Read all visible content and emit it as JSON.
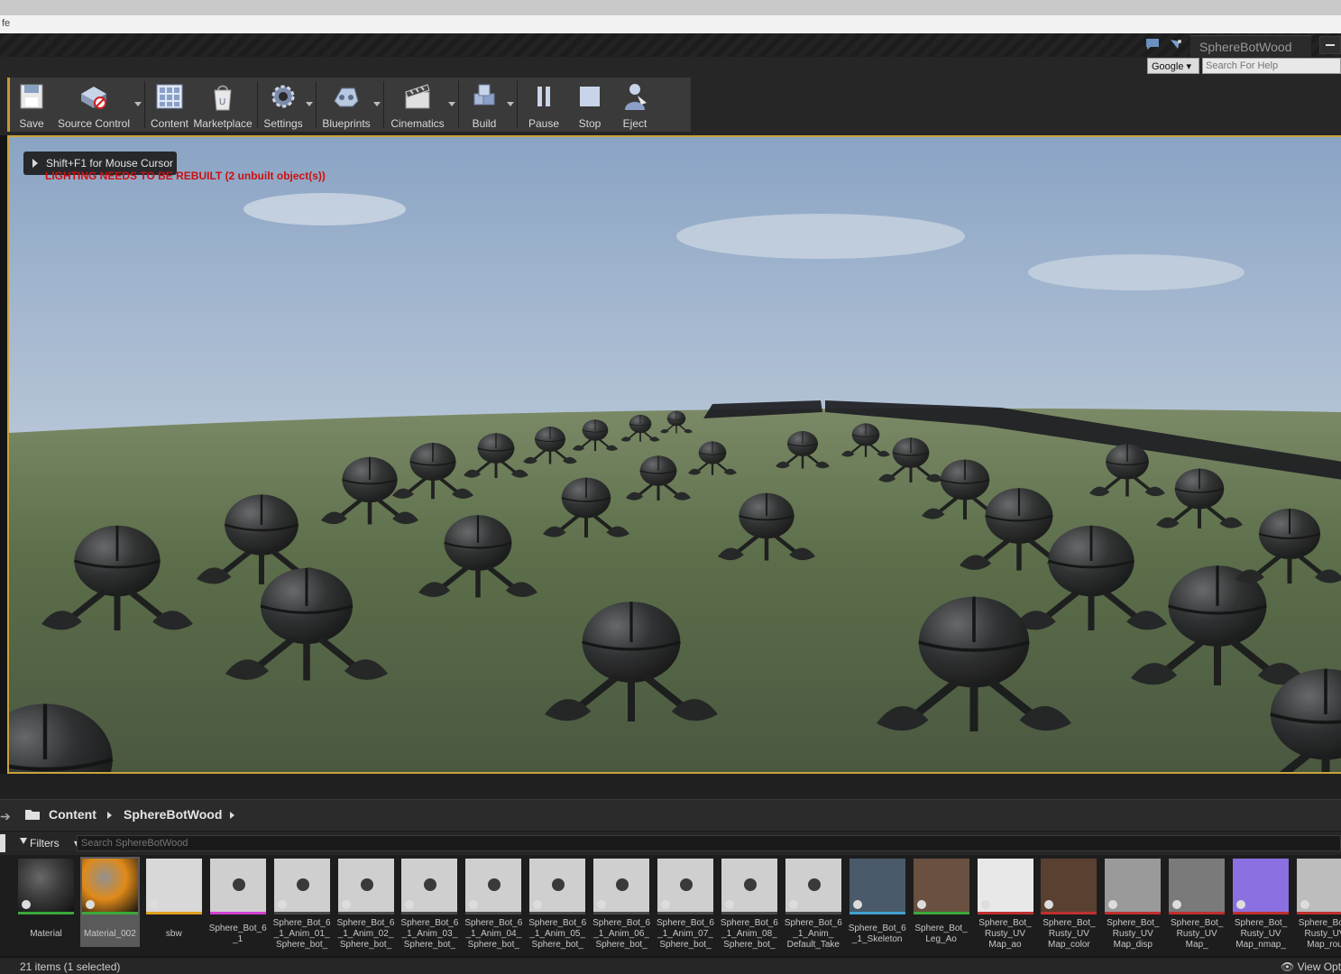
{
  "window": {
    "menu_fragment": "fe",
    "tab_title": "SphereBotWood",
    "search_engine": "Google",
    "help_placeholder": "Search For Help"
  },
  "toolbar": {
    "buttons": [
      {
        "label": "Save",
        "icon": "save-icon"
      },
      {
        "label": "Source Control",
        "icon": "source-control-icon"
      },
      {
        "label": "Content",
        "icon": "content-icon"
      },
      {
        "label": "Marketplace",
        "icon": "marketplace-icon"
      },
      {
        "label": "Settings",
        "icon": "settings-icon"
      },
      {
        "label": "Blueprints",
        "icon": "blueprints-icon"
      },
      {
        "label": "Cinematics",
        "icon": "cinematics-icon"
      },
      {
        "label": "Build",
        "icon": "build-icon"
      },
      {
        "label": "Pause",
        "icon": "pause-icon"
      },
      {
        "label": "Stop",
        "icon": "stop-icon"
      },
      {
        "label": "Eject",
        "icon": "eject-icon"
      }
    ]
  },
  "viewport": {
    "hint": "Shift+F1 for Mouse Cursor",
    "warning": "LIGHTING NEEDS TO BE REBUILT (2 unbuilt object(s))"
  },
  "content_browser": {
    "breadcrumb": [
      "Content",
      "SphereBotWood"
    ],
    "filters_label": "Filters",
    "search_placeholder": "Search SphereBotWood",
    "assets": [
      {
        "label": "Material",
        "color": "#3a3a3a",
        "bar": "#3aa83a"
      },
      {
        "label": "Material_002",
        "color": "#e08a18",
        "bar": "#3aa83a",
        "selected": true
      },
      {
        "label": "sbw",
        "color": "#d8d8d8",
        "bar": "#e0a020"
      },
      {
        "label": "Sphere_Bot_6\n_1",
        "color": "#cfcfcf",
        "bar": "#d040d0"
      },
      {
        "label": "Sphere_Bot_6\n_1_Anim_01_\nSphere_bot_",
        "color": "#cfcfcf",
        "bar": "#4a4a4a"
      },
      {
        "label": "Sphere_Bot_6\n_1_Anim_02_\nSphere_bot_",
        "color": "#cfcfcf",
        "bar": "#4a4a4a"
      },
      {
        "label": "Sphere_Bot_6\n_1_Anim_03_\nSphere_bot_",
        "color": "#cfcfcf",
        "bar": "#4a4a4a"
      },
      {
        "label": "Sphere_Bot_6\n_1_Anim_04_\nSphere_bot_",
        "color": "#cfcfcf",
        "bar": "#4a4a4a"
      },
      {
        "label": "Sphere_Bot_6\n_1_Anim_05_\nSphere_bot_",
        "color": "#cfcfcf",
        "bar": "#4a4a4a"
      },
      {
        "label": "Sphere_Bot_6\n_1_Anim_06_\nSphere_bot_",
        "color": "#cfcfcf",
        "bar": "#4a4a4a"
      },
      {
        "label": "Sphere_Bot_6\n_1_Anim_07_\nSphere_bot_",
        "color": "#cfcfcf",
        "bar": "#4a4a4a"
      },
      {
        "label": "Sphere_Bot_6\n_1_Anim_08_\nSphere_bot_",
        "color": "#cfcfcf",
        "bar": "#4a4a4a"
      },
      {
        "label": "Sphere_Bot_6\n_1_Anim_\nDefault_Take",
        "color": "#cfcfcf",
        "bar": "#4a4a4a"
      },
      {
        "label": "Sphere_Bot_6\n_1_Skeleton",
        "color": "#4a5a6a",
        "bar": "#40a0d0"
      },
      {
        "label": "Sphere_Bot_\nLeg_Ao",
        "color": "#6a5040",
        "bar": "#3aa83a"
      },
      {
        "label": "Sphere_Bot_\nRusty_UV\nMap_ao",
        "color": "#e8e8e8",
        "bar": "#c03030"
      },
      {
        "label": "Sphere_Bot_\nRusty_UV\nMap_color",
        "color": "#5a4030",
        "bar": "#c03030"
      },
      {
        "label": "Sphere_Bot_\nRusty_UV\nMap_disp",
        "color": "#9a9a9a",
        "bar": "#c03030"
      },
      {
        "label": "Sphere_Bot_\nRusty_UV\nMap_",
        "color": "#7a7a7a",
        "bar": "#c03030"
      },
      {
        "label": "Sphere_Bot_\nRusty_UV\nMap_nmap_",
        "color": "#8a70e0",
        "bar": "#c03030"
      },
      {
        "label": "Sphere_Bot_\nRusty_UV\nMap_rou",
        "color": "#bdbdbd",
        "bar": "#c03030"
      }
    ],
    "status": "21 items (1 selected)",
    "view_options": "View Opt"
  }
}
